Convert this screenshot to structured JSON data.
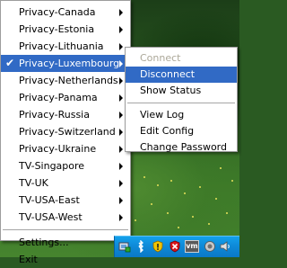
{
  "main_menu": {
    "items": [
      {
        "label": "Privacy-Canada"
      },
      {
        "label": "Privacy-Estonia"
      },
      {
        "label": "Privacy-Lithuania"
      },
      {
        "label": "Privacy-Luxembourg"
      },
      {
        "label": "Privacy-Netherlands"
      },
      {
        "label": "Privacy-Panama"
      },
      {
        "label": "Privacy-Russia"
      },
      {
        "label": "Privacy-Switzerland"
      },
      {
        "label": "Privacy-Ukraine"
      },
      {
        "label": "TV-Singapore"
      },
      {
        "label": "TV-UK"
      },
      {
        "label": "TV-USA-East"
      },
      {
        "label": "TV-USA-West"
      }
    ],
    "settings_label": "Settings...",
    "exit_label": "Exit"
  },
  "sub_menu": {
    "connect_label": "Connect",
    "disconnect_label": "Disconnect",
    "show_status_label": "Show Status",
    "view_log_label": "View Log",
    "edit_config_label": "Edit Config",
    "change_password_label": "Change Password"
  },
  "tray": {
    "icons": [
      "openvpn-tray-icon",
      "bluetooth-icon",
      "security-shield-icon",
      "antivirus-icon",
      "vmware-icon",
      "network-icon",
      "speaker-icon"
    ],
    "vmware_text": "vm"
  },
  "colors": {
    "menu_highlight": "#316ac5",
    "disabled_text": "#aca899",
    "taskbar": "#0e8ad8"
  }
}
